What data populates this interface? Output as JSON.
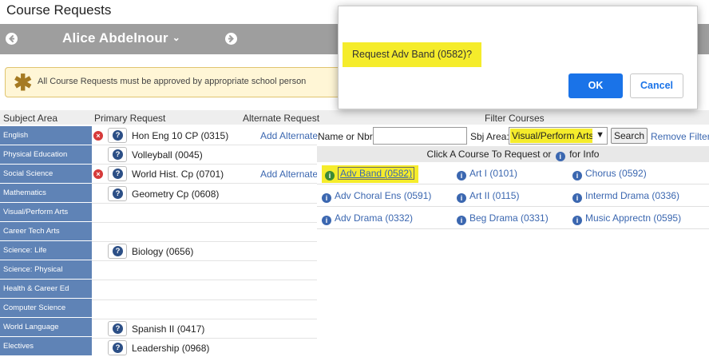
{
  "page": {
    "title": "Course Requests"
  },
  "student_bar": {
    "name": "Alice Abdelnour",
    "prev_icon": "left-arrow-circle-icon",
    "next_icon": "right-arrow-circle-icon"
  },
  "notice": {
    "icon": "asterisk-icon",
    "text": "All Course Requests must be approved by appropriate school person",
    "background": "#fff6d6"
  },
  "columns": {
    "subject_area": "Subject Area",
    "primary_request": "Primary Request",
    "alternate_request": "Alternate Request",
    "filter_courses": "Filter Courses"
  },
  "subjects": [
    {
      "label": "English",
      "primary": "Hon Eng 10 CP (0315)",
      "removable": true,
      "alternate": "Add Alternate"
    },
    {
      "label": "Physical Education",
      "primary": "Volleyball (0045)",
      "removable": false,
      "alternate": ""
    },
    {
      "label": "Social Science",
      "primary": "World Hist. Cp (0701)",
      "removable": true,
      "alternate": "Add Alternate"
    },
    {
      "label": "Mathematics",
      "primary": "Geometry Cp (0608)",
      "removable": false,
      "alternate": ""
    },
    {
      "label": "Visual/Perform Arts",
      "primary": "",
      "removable": false,
      "alternate": ""
    },
    {
      "label": "Career Tech Arts",
      "primary": "",
      "removable": false,
      "alternate": ""
    },
    {
      "label": "Science: Life",
      "primary": "Biology (0656)",
      "removable": false,
      "alternate": ""
    },
    {
      "label": "Science: Physical",
      "primary": "",
      "removable": false,
      "alternate": ""
    },
    {
      "label": "Health & Career Ed",
      "primary": "",
      "removable": false,
      "alternate": ""
    },
    {
      "label": "Computer Science",
      "primary": "",
      "removable": false,
      "alternate": ""
    },
    {
      "label": "World Language",
      "primary": "Spanish II (0417)",
      "removable": false,
      "alternate": ""
    },
    {
      "label": "Electives",
      "primary": "Leadership (0968)",
      "removable": false,
      "alternate": ""
    }
  ],
  "filter": {
    "name_label": "Name or Nbr:",
    "name_value": "",
    "sbj_label": "Sbj Area:",
    "sbj_value": "Visual/Perform Arts",
    "search_label": "Search",
    "remove_label": "Remove Filter",
    "results_header_before": "Click A Course To Request or",
    "results_header_after": "for Info"
  },
  "results": [
    [
      "Adv Band (0582)",
      "Art I (0101)",
      "Chorus (0592)"
    ],
    [
      "Adv Choral Ens (0591)",
      "Art II (0115)",
      "Intermd Drama (0336)"
    ],
    [
      "Adv Drama (0332)",
      "Beg Drama (0331)",
      "Music Apprectn (0595)"
    ]
  ],
  "dialog": {
    "message": "Request Adv Band (0582)?",
    "ok_label": "OK",
    "cancel_label": "Cancel"
  },
  "colors": {
    "subject_bg": "#5f83b6",
    "link": "#3b67b0",
    "highlight": "#f5ec2b",
    "ok_button": "#1a73e8",
    "remove_icon": "#d63a3a"
  }
}
